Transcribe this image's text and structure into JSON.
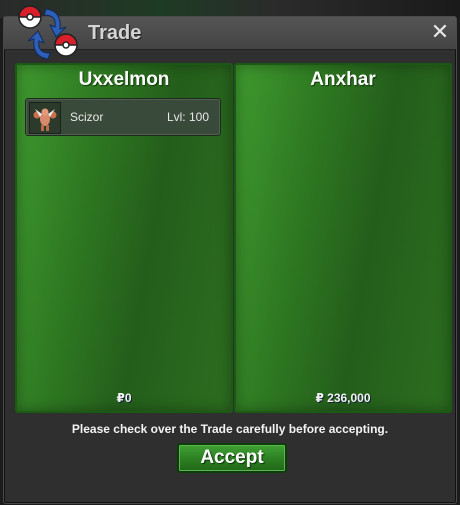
{
  "window": {
    "title": "Trade",
    "close_glyph": "✕",
    "icon": "trade-swap-icon"
  },
  "left_panel": {
    "trainer_name": "Uxxelmon",
    "pokemon": [
      {
        "name": "Scizor",
        "level_text": "Lvl: 100",
        "icon": "scizor-sprite-icon"
      }
    ],
    "money_text": "₽0"
  },
  "right_panel": {
    "trainer_name": "Anxhar",
    "pokemon": [],
    "money_text": "₽ 236,000"
  },
  "footer": {
    "notice": "Please check over the Trade carefully before accepting.",
    "accept_label": "Accept"
  },
  "colors": {
    "panel_green": "#2f7a22",
    "titlebar": "#4b4b4b",
    "window_bg": "#2f2f2f"
  }
}
